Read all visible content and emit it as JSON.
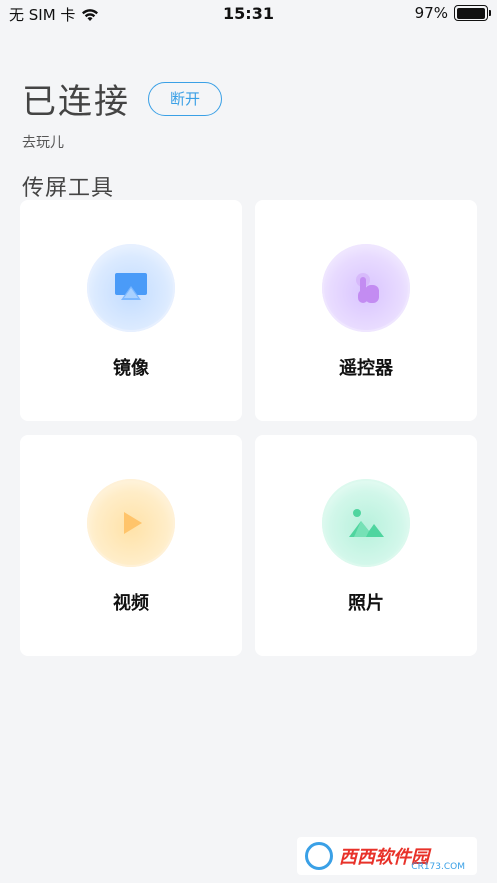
{
  "status_bar": {
    "carrier": "无 SIM 卡",
    "time": "15:31",
    "battery": "97%",
    "battery_level": 0.97
  },
  "header": {
    "connection_status": "已连接",
    "disconnect_label": "断开",
    "device_name": "去玩儿"
  },
  "section": {
    "title": "传屏工具"
  },
  "tools": [
    {
      "label": "镜像",
      "icon": "screen-mirror-icon",
      "color": "#4a9bf8"
    },
    {
      "label": "遥控器",
      "icon": "touch-hand-icon",
      "color": "#c38cf2"
    },
    {
      "label": "视频",
      "icon": "play-icon",
      "color": "#ffc46b"
    },
    {
      "label": "照片",
      "icon": "image-icon",
      "color": "#4fd59f"
    }
  ],
  "watermark": {
    "brand": "西西软件园",
    "sub": "CR173.COM"
  }
}
